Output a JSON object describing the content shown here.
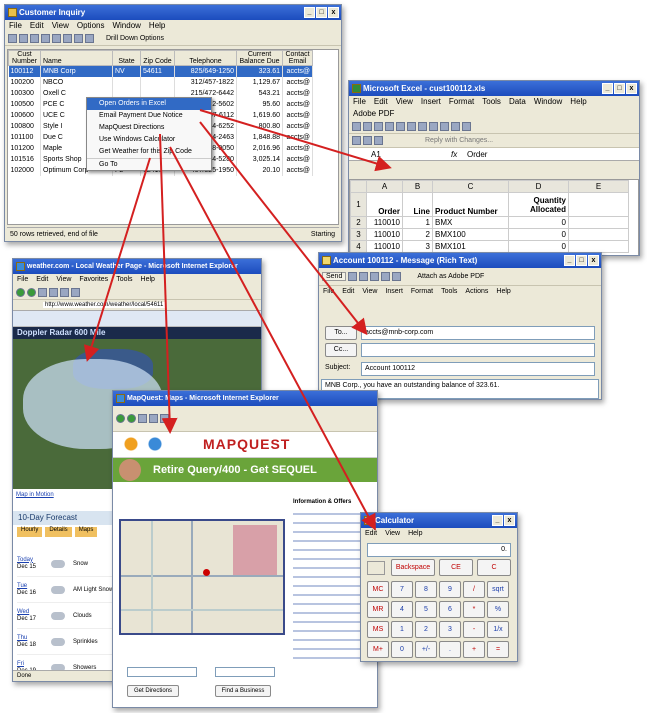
{
  "inquiry": {
    "title": "Customer Inquiry",
    "menu": [
      "File",
      "Edit",
      "View",
      "Options",
      "Window",
      "Help"
    ],
    "drill_label": "Drill Down Options",
    "columns": [
      "Cust Number",
      "Name",
      "State",
      "Zip Code",
      "Telephone",
      "Current Balance Due",
      "Contact Email"
    ],
    "rows": [
      [
        "100112",
        "MNB Corp",
        "NV",
        "54611",
        "825/649-1250",
        "323.61",
        "accts@"
      ],
      [
        "100200",
        "NBCO",
        "",
        "",
        "312/457-1822",
        "1,129.67",
        "accts@"
      ],
      [
        "100300",
        "Oxell C",
        "",
        "",
        "215/472-6442",
        "543.21",
        "accts@"
      ],
      [
        "100500",
        "PCE C",
        "",
        "",
        "319/752-5602",
        "95.60",
        "accts@"
      ],
      [
        "100600",
        "UCE C",
        "",
        "",
        "312/437-6112",
        "1,619.60",
        "accts@"
      ],
      [
        "100800",
        "Style I",
        "",
        "",
        "815/514-6252",
        "800.80",
        "accts@"
      ],
      [
        "101100",
        "Due C",
        "",
        "",
        "307/264-2463",
        "1,848.88",
        "accts@"
      ],
      [
        "101200",
        "Maple",
        "",
        "",
        "505/248-0050",
        "2,016.96",
        "accts@"
      ],
      [
        "101516",
        "Sports Shop",
        "AZ",
        "31550",
        "520/444-5280",
        "3,025.14",
        "accts@"
      ],
      [
        "102000",
        "Optimum Corp",
        "FL",
        "62410",
        "407/525-1950",
        "20.10",
        "accts@"
      ]
    ],
    "status": "50 rows retrieved, end of file",
    "status_right": "Starting"
  },
  "context_menu": [
    "Open Orders in Excel",
    "Email Payment Due Notice",
    "MapQuest Directions",
    "Use Windows Calculator",
    "Get Weather for this Zip Code",
    "Go To"
  ],
  "excel": {
    "title": "Microsoft Excel - cust100112.xls",
    "menu": [
      "File",
      "Edit",
      "View",
      "Insert",
      "Format",
      "Tools",
      "Data",
      "Window",
      "Help"
    ],
    "adobe": "Adobe PDF",
    "reply": "Reply with Changes...",
    "cell_ref": "A1",
    "formula": "Order",
    "col_letters": [
      "A",
      "B",
      "C",
      "D",
      "E"
    ],
    "headers": [
      "Order",
      "Line",
      "Product Number",
      "Quantity Allocated"
    ],
    "rows": [
      [
        "110010",
        "1",
        "BMX",
        "0"
      ],
      [
        "110010",
        "2",
        "BMX100",
        "0"
      ],
      [
        "110010",
        "3",
        "BMX101",
        "0"
      ]
    ]
  },
  "message": {
    "title": "Account 100112 - Message (Rich Text)",
    "send": "Send",
    "attach": "Attach as Adobe PDF",
    "menu": [
      "File",
      "Edit",
      "View",
      "Insert",
      "Format",
      "Tools",
      "Actions",
      "Help"
    ],
    "to_label": "To...",
    "to_value": "accts@mnb-corp.com",
    "cc_label": "Cc...",
    "subject_label": "Subject:",
    "subject_value": "Account 100112",
    "body": "MNB Corp., you have an outstanding balance of 323.61."
  },
  "weather": {
    "title": "weather.com - Local Weather Page - Microsoft Internet Explorer",
    "menu": [
      "File",
      "Edit",
      "View",
      "Favorites",
      "Tools",
      "Help"
    ],
    "address": "http://www.weather.com/weather/local/54611",
    "radar": "Doppler Radar 600 Mile",
    "forecast": "10-Day Forecast",
    "tabs": [
      "Hourly",
      "Details",
      "Maps"
    ],
    "days": [
      [
        "Today",
        "Dec 15",
        "Snow"
      ],
      [
        "Tue",
        "Dec 16",
        "AM Light Snow"
      ],
      [
        "Wed",
        "Dec 17",
        "Clouds"
      ],
      [
        "Thu",
        "Dec 18",
        "Sprinkles"
      ],
      [
        "Fri",
        "Dec 19",
        "Showers"
      ]
    ],
    "status": "Done"
  },
  "mapquest": {
    "title": "MapQuest: Maps - Microsoft Internet Explorer",
    "logo": "MAPQUEST",
    "banner": "Retire Query/400 - Get SEQUEL",
    "panel_title": "Information & Offers",
    "buttons": [
      "Get Directions",
      "Find a Business"
    ]
  },
  "calc": {
    "title": "Calculator",
    "menu": [
      "Edit",
      "View",
      "Help"
    ],
    "display": "0.",
    "top": [
      "Backspace",
      "CE",
      "C"
    ],
    "rows": [
      [
        "MC",
        "7",
        "8",
        "9",
        "/",
        "sqrt"
      ],
      [
        "MR",
        "4",
        "5",
        "6",
        "*",
        "%"
      ],
      [
        "MS",
        "1",
        "2",
        "3",
        "-",
        "1/x"
      ],
      [
        "M+",
        "0",
        "+/-",
        ".",
        "+",
        "="
      ]
    ]
  },
  "colors": {
    "arrow": "#d42020",
    "titlebar": "#1c4cbd",
    "banner": "#6aa43a"
  }
}
